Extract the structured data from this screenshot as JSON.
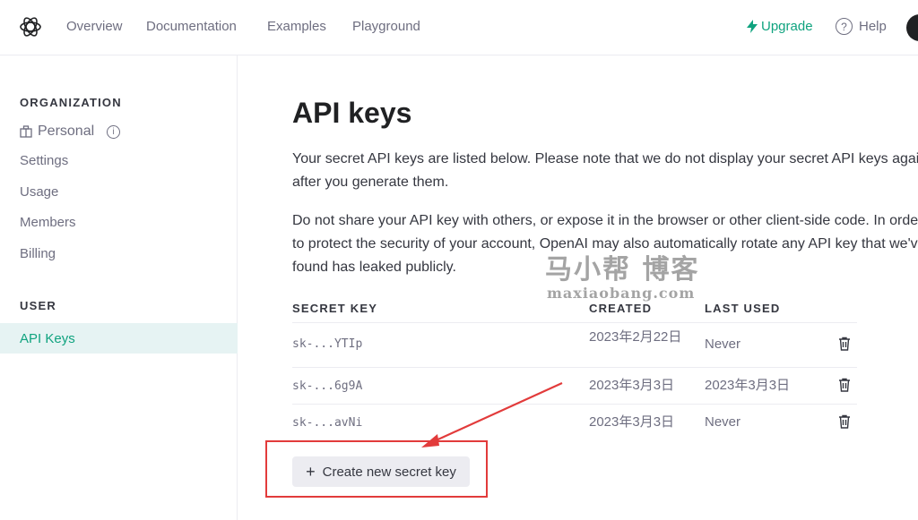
{
  "topnav": {
    "logo_icon": "openai-logo-icon",
    "links": [
      "Overview",
      "Documentation",
      "Examples",
      "Playground"
    ],
    "upgrade_label": "Upgrade",
    "upgrade_icon": "bolt-icon",
    "help_label": "Help",
    "help_icon": "question-circle-icon"
  },
  "sidebar": {
    "org_heading": "ORGANIZATION",
    "org_name": "Personal",
    "org_items": [
      "Settings",
      "Usage",
      "Members",
      "Billing"
    ],
    "user_heading": "USER",
    "active_item": "API Keys",
    "accent_color": "#10a37f"
  },
  "main": {
    "title": "API keys",
    "para1": "Your secret API keys are listed below. Please note that we do not display your secret API keys again after you generate them.",
    "para2": "Do not share your API key with others, or expose it in the browser or other client-side code. In order to protect the security of your account, OpenAI may also automatically rotate any API key that we've found has leaked publicly.",
    "table": {
      "headers": [
        "SECRET KEY",
        "CREATED",
        "LAST USED"
      ],
      "rows": [
        {
          "key": "sk-...YTIp",
          "created": "2023年2月22日",
          "last_used": "Never"
        },
        {
          "key": "sk-...6g9A",
          "created": "2023年3月3日",
          "last_used": "2023年3月3日"
        },
        {
          "key": "sk-...avNi",
          "created": "2023年3月3日",
          "last_used": "Never"
        }
      ]
    },
    "create_button": "Create new secret key"
  },
  "watermark": {
    "chinese": "马小帮 博客",
    "url": "maxiaobang.com"
  },
  "annotation_color": "#e23b3b"
}
